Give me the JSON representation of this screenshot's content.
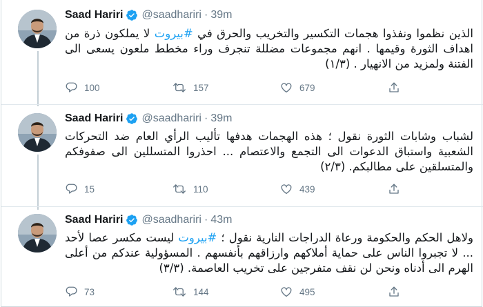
{
  "tweets": [
    {
      "author": "Saad Hariri",
      "handle": "@saadhariri",
      "separator": "·",
      "time": "39m",
      "text_before": "الذين نظموا ونفذوا هجمات التكسير والتخريب والحرق في ",
      "hashtag": "#بيروت",
      "text_after": " لا يملكون ذرة من اهداف الثورة وقيمها . انهم مجموعات مضللة تنجرف وراء مخطط ملعون يسعى الى الفتنة ولمزيد من الانهيار . (١/٣)",
      "replies": "100",
      "retweets": "157",
      "likes": "679"
    },
    {
      "author": "Saad Hariri",
      "handle": "@saadhariri",
      "separator": "·",
      "time": "39m",
      "text_before": "لشباب وشابات الثورة نقول ؛ هذه الهجمات هدفها تأليب الرأي العام ضد التحركات الشعبية واستباق الدعوات الى التجمع والاعتصام ... احذروا المتسللين الى صفوفكم والمتسلقين على مطالبكم. (٢/٣)",
      "hashtag": "",
      "text_after": "",
      "replies": "15",
      "retweets": "110",
      "likes": "439"
    },
    {
      "author": "Saad Hariri",
      "handle": "@saadhariri",
      "separator": "·",
      "time": "43m",
      "text_before": "ولاهل الحكم والحكومة ورعاة الدراجات النارية نقول ؛ ",
      "hashtag": "#بيروت",
      "text_after": " ليست مكسر عصا لأحد ... لا تجبروا الناس على حماية أملاكهم وارزاقهم بأنفسهم . المسؤولية عندكم من أعلى الهرم الى أدناه ونحن لن نقف متفرجين على تخريب العاصمة. (٣/٣)",
      "replies": "73",
      "retweets": "144",
      "likes": "495"
    }
  ],
  "colors": {
    "accent": "#1da1f2",
    "muted": "#657786",
    "text": "#14171a",
    "verified": "#1da1f2",
    "thread_line": "#c4cfd6"
  },
  "icons": {
    "reply": "reply-icon",
    "retweet": "retweet-icon",
    "like": "heart-icon",
    "share": "share-icon",
    "verified": "verified-badge-icon"
  }
}
